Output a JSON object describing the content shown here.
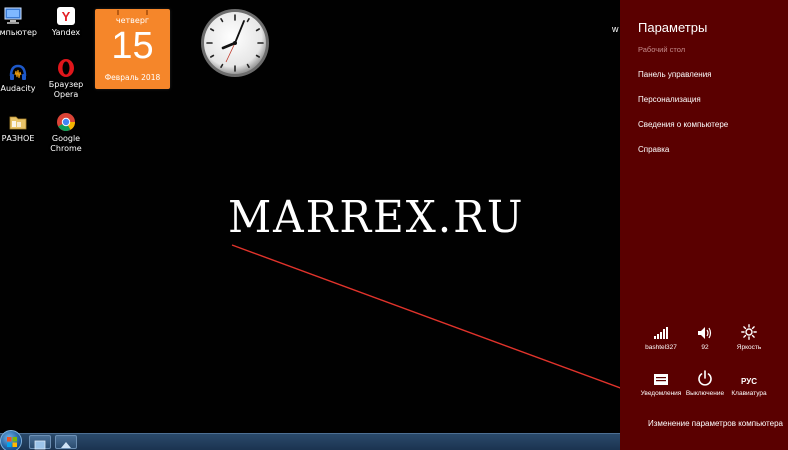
{
  "desktop": {
    "icons": [
      {
        "label": "Компьютер",
        "icon": "computer-icon"
      },
      {
        "label": "Yandex",
        "icon": "yandex-icon"
      },
      {
        "label": "Audacity",
        "icon": "audacity-icon"
      },
      {
        "label": "Браузер Opera",
        "icon": "opera-icon"
      },
      {
        "label": "РАЗНОЕ",
        "icon": "folder-icon"
      },
      {
        "label": "Google Chrome",
        "icon": "chrome-icon"
      }
    ],
    "edge_char": "w"
  },
  "calendar": {
    "weekday": "четверг",
    "day": "15",
    "month_year": "Февраль 2018"
  },
  "watermark": "MARREX.RU",
  "colors": {
    "charm_bg": "#5a0000",
    "calendar_bg": "#f5862a",
    "arrow": "#e0332b"
  },
  "charm": {
    "title": "Параметры",
    "subtitle": "Рабочий стол",
    "links": [
      "Панель управления",
      "Персонализация",
      "Сведения о компьютере",
      "Справка"
    ],
    "tiles": [
      {
        "label": "bashtel327",
        "icon": "wifi-signal-icon"
      },
      {
        "label": "92",
        "icon": "speaker-icon"
      },
      {
        "label": "Яркость",
        "icon": "brightness-icon"
      },
      {
        "label": "Уведомления",
        "icon": "notifications-icon"
      },
      {
        "label": "Выключение",
        "icon": "power-icon"
      },
      {
        "label": "Клавиатура",
        "icon": "keyboard-icon",
        "glyph": "РУС"
      }
    ],
    "bottom_link": "Изменение параметров компьютера"
  }
}
